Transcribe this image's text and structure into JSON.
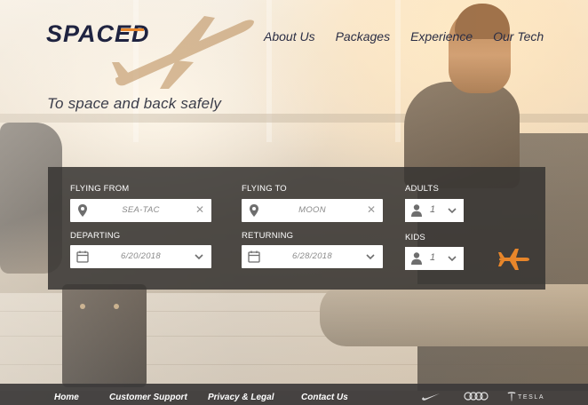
{
  "brand": {
    "logo_text": "SPACED",
    "accent": "#e8862a",
    "dark": "#1f2340"
  },
  "nav": [
    {
      "label": "About Us"
    },
    {
      "label": "Packages"
    },
    {
      "label": "Experience"
    },
    {
      "label": "Our Tech"
    }
  ],
  "hero": {
    "tagline": "To space and back safely"
  },
  "booking": {
    "flying_from": {
      "label": "FLYING FROM",
      "value": "SEA-TAC",
      "icon": "location-pin-icon"
    },
    "flying_to": {
      "label": "FLYING TO",
      "value": "MOON",
      "icon": "location-pin-icon"
    },
    "departing": {
      "label": "DEPARTING",
      "value": "6/20/2018",
      "icon": "calendar-icon"
    },
    "returning": {
      "label": "RETURNING",
      "value": "6/28/2018",
      "icon": "calendar-icon"
    },
    "adults": {
      "label": "ADULTS",
      "value": "1",
      "icon": "person-icon"
    },
    "kids": {
      "label": "KIDS",
      "value": "1",
      "icon": "person-icon"
    },
    "submit_icon": "airplane-icon"
  },
  "footer": {
    "links": [
      {
        "label": "Home"
      },
      {
        "label": "Customer Support"
      },
      {
        "label": "Privacy & Legal"
      },
      {
        "label": "Contact Us"
      }
    ],
    "partners": [
      {
        "name": "nike",
        "icon": "nike-swoosh-icon"
      },
      {
        "name": "audi",
        "icon": "audi-rings-icon"
      },
      {
        "name": "tesla",
        "icon": "tesla-logo-icon",
        "text": "TESLA"
      }
    ]
  }
}
